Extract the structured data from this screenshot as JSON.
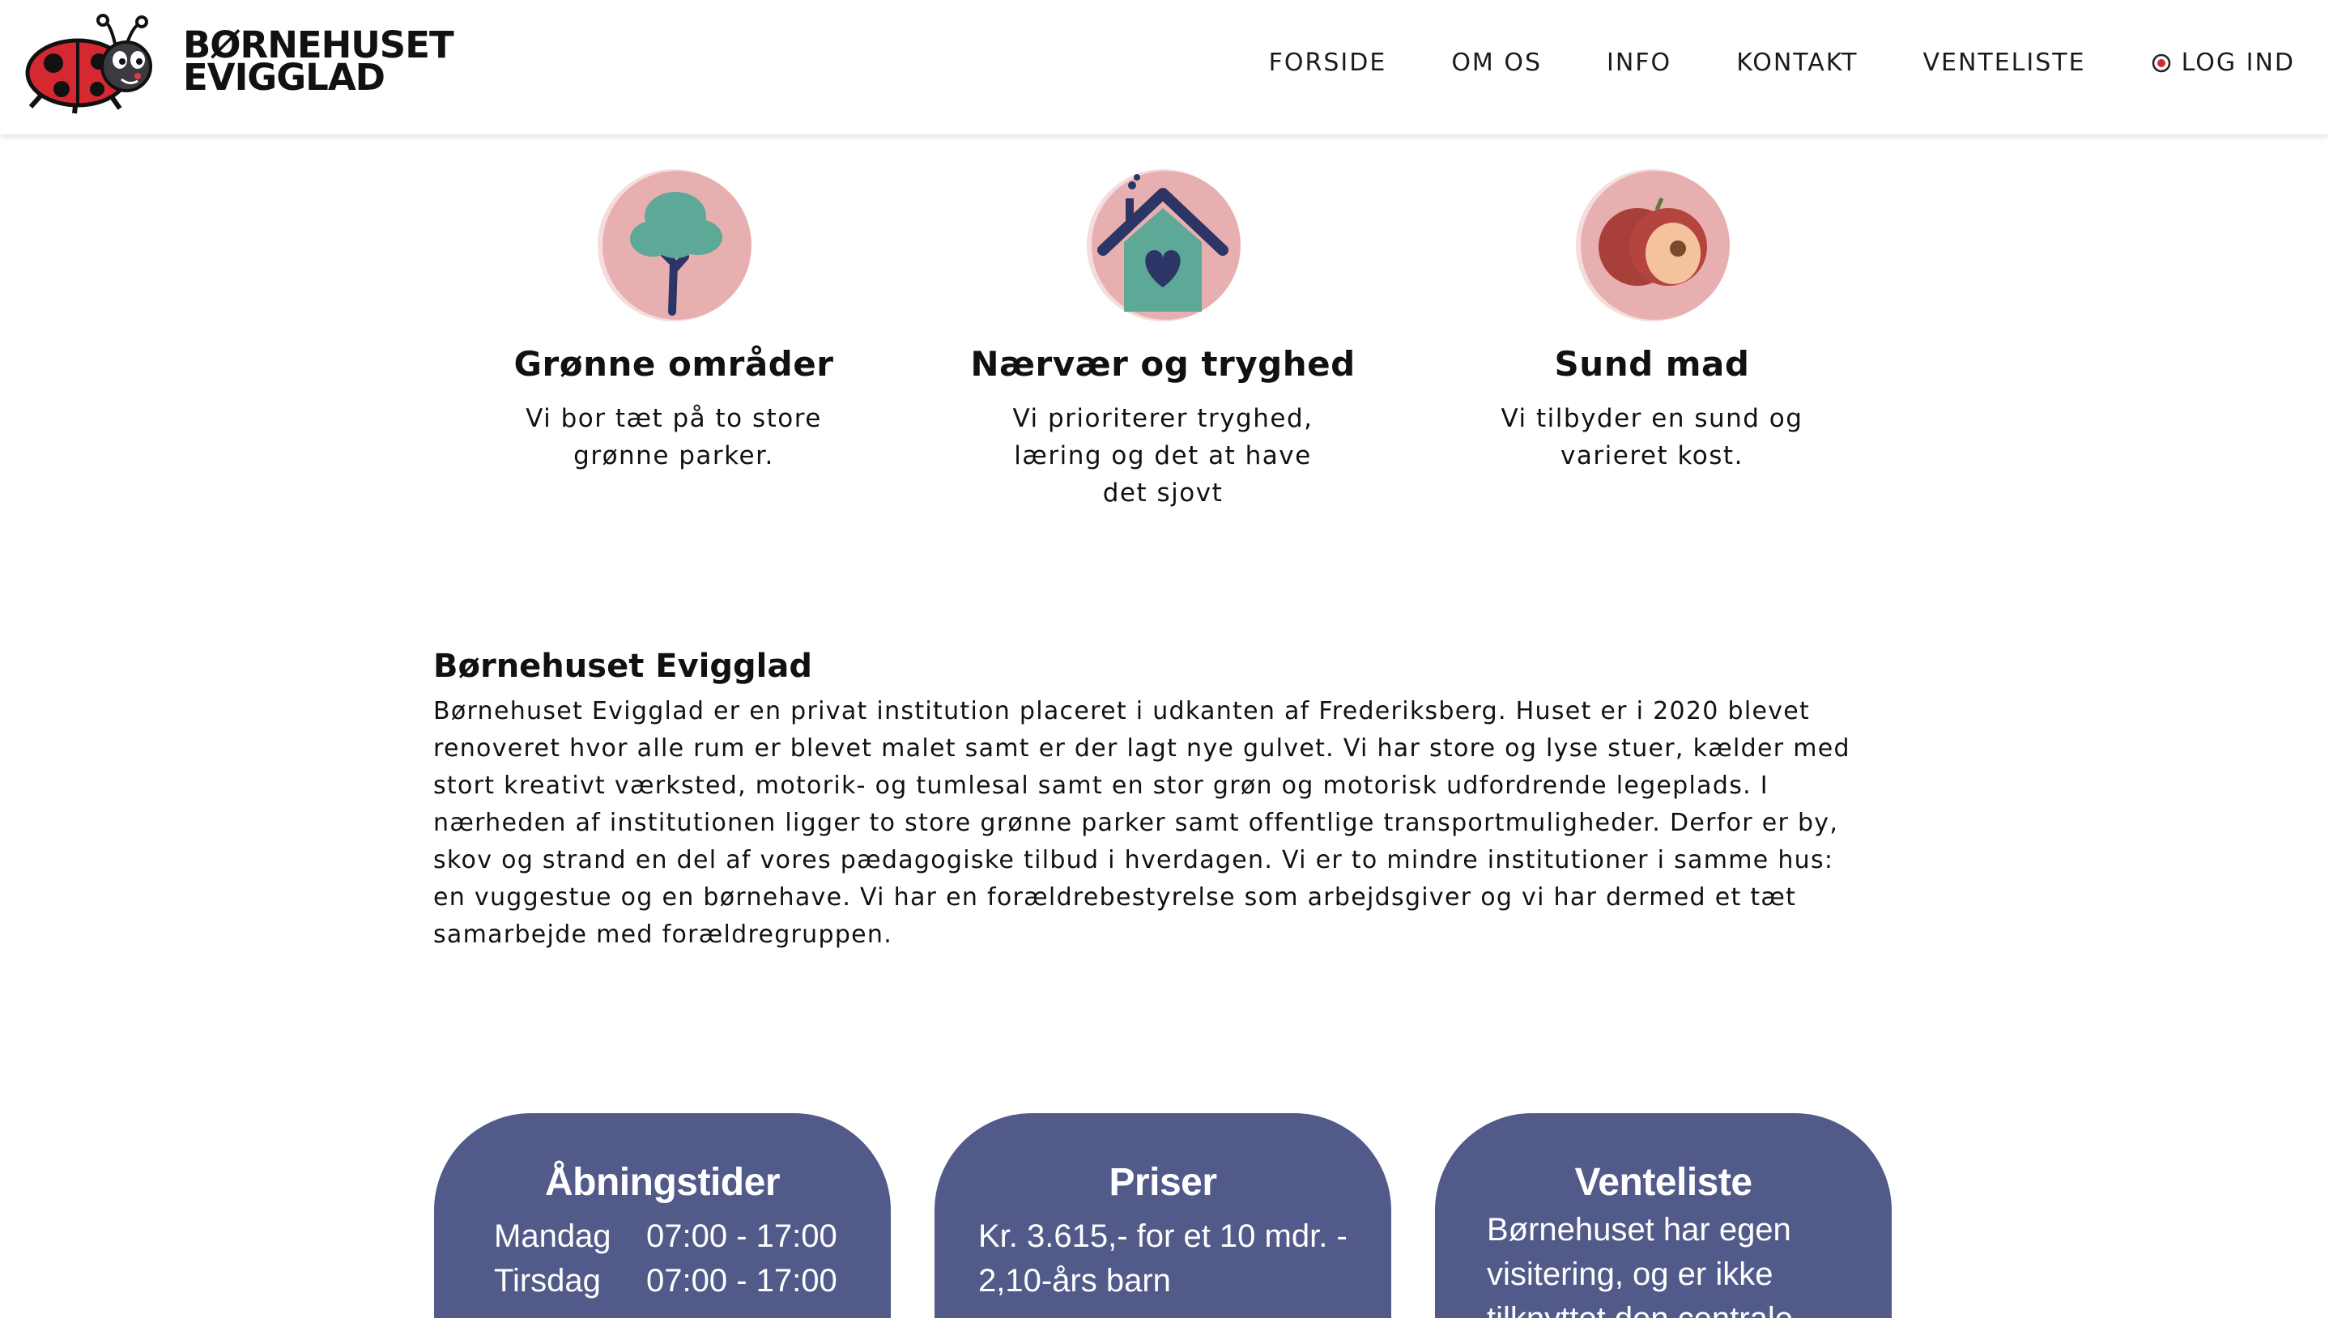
{
  "header": {
    "brand_line1": "BØRNEHUSET",
    "brand_line2": "EVIGGLAD",
    "nav": [
      "FORSIDE",
      "OM OS",
      "INFO",
      "KONTAKT",
      "VENTELISTE"
    ],
    "login_label": "LOG IND",
    "login_icon": "lock-icon"
  },
  "features": [
    {
      "icon": "tree-icon",
      "title": "Grønne områder",
      "text": "Vi bor tæt på to store grønne parker."
    },
    {
      "icon": "house-heart-icon",
      "title": "Nærvær og tryghed",
      "text": "Vi prioriterer tryghed, læring og det at have det sjovt"
    },
    {
      "icon": "apple-icon",
      "title": "Sund mad",
      "text": "Vi tilbyder en sund og varieret kost."
    }
  ],
  "about": {
    "title": "Børnehuset Evigglad",
    "lines": [
      "Børnehuset Evigglad er en privat institution placeret i udkanten af Frederiksberg. Huset er i 2020 blevet",
      "renoveret hvor alle rum er blevet malet samt er der lagt nye gulvet. Vi har store og lyse stuer, kælder med",
      "stort kreativt værksted, motorik- og tumlesal samt en stor grøn og motorisk udfordrende legeplads. I",
      "nærheden af institutionen ligger to store grønne parker samt offentlige transportmuligheder. Derfor er by,",
      "skov og strand en del af vores pædagogiske tilbud i hverdagen. Vi er to mindre institutioner i samme hus:",
      "en vuggestue og en børnehave. Vi har en forældrebestyrelse som arbejdsgiver og vi har dermed et tæt",
      "samarbejde med forældregruppen."
    ]
  },
  "cards": {
    "hours": {
      "title": "Åbningstider",
      "rows": [
        {
          "day": "Mandag",
          "time": "07:00 - 17:00"
        },
        {
          "day": "Tirsdag",
          "time": "07:00 - 17:00"
        }
      ]
    },
    "prices": {
      "title": "Priser",
      "line1": "Kr. 3.615,- for et 10 mdr. -",
      "line2": "2,10-års barn"
    },
    "waitlist": {
      "title": "Venteliste",
      "line1": "Børnehuset har egen",
      "line2": "visitering, og er ikke",
      "line3": "tilknyttet den centrale"
    }
  },
  "colors": {
    "card_bg": "#525a8a",
    "icon_circle": "#e8afb0",
    "nav_text": "#1b1b1b"
  }
}
